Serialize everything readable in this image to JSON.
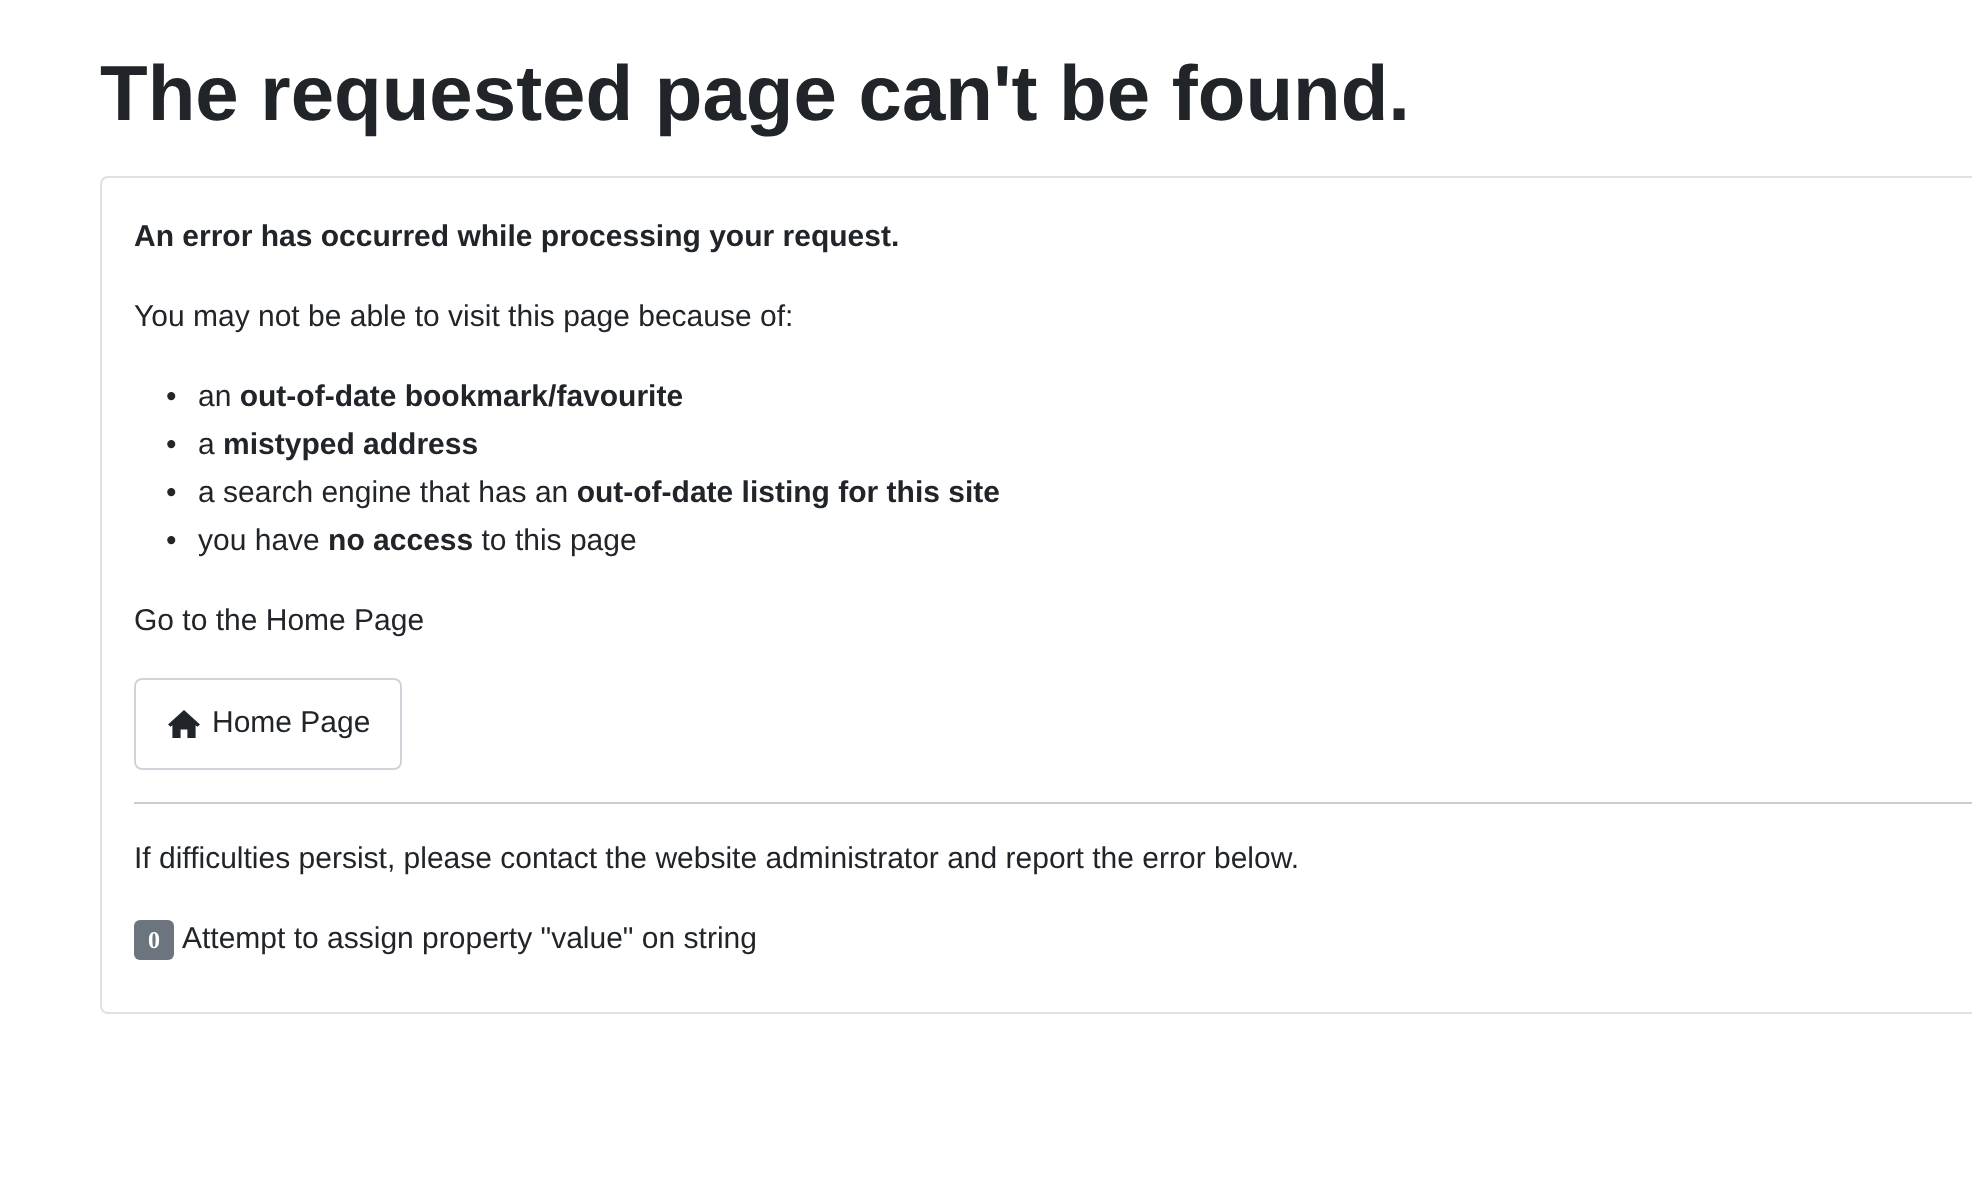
{
  "heading": "The requested page can't be found.",
  "card": {
    "error_title": "An error has occurred while processing your request.",
    "intro": "You may not be able to visit this page because of:",
    "reasons": [
      {
        "marker": "•",
        "text": "an **out-of-date bookmark/favourite**"
      },
      {
        "marker": "•",
        "text": "a **mistyped address**"
      },
      {
        "marker": "•",
        "text": "a search engine that has an **out-of-date listing for this site**"
      },
      {
        "marker": "•",
        "text": "you have **no access** to this page"
      }
    ],
    "home_prompt": "Go to the Home Page",
    "home_button": "Home Page",
    "contact_note": "If difficulties persist, please contact the website administrator and report the error below.",
    "error_code": "0",
    "error_message": "Attempt to assign property \"value\" on string"
  }
}
